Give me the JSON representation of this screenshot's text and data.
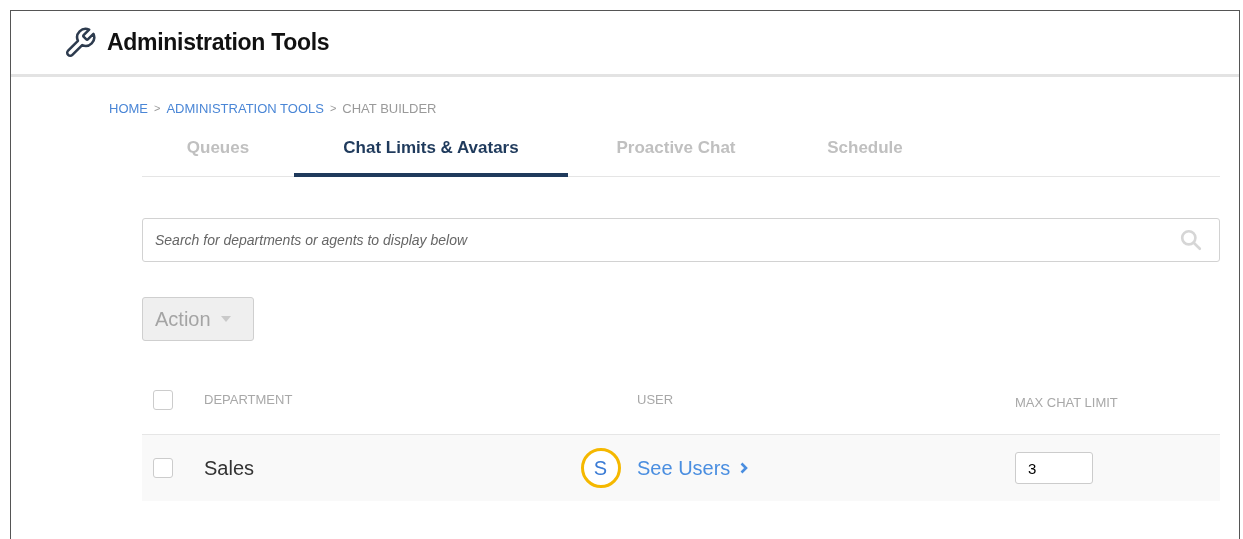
{
  "header": {
    "title": "Administration Tools"
  },
  "breadcrumb": [
    {
      "label": "HOME",
      "kind": "link"
    },
    {
      "label": "ADMINISTRATION TOOLS",
      "kind": "link"
    },
    {
      "label": "CHAT BUILDER",
      "kind": "current"
    }
  ],
  "breadcrumb_separator": ">",
  "tabs": [
    {
      "label": "Queues",
      "selected": false
    },
    {
      "label": "Chat Limits & Avatars",
      "selected": true
    },
    {
      "label": "Proactive Chat",
      "selected": false
    },
    {
      "label": "Schedule",
      "selected": false
    }
  ],
  "search": {
    "placeholder": "Search for departments or agents to display below"
  },
  "action_button": {
    "label": "Action",
    "disabled": true
  },
  "table": {
    "select_all_checked": false,
    "columns": [
      "DEPARTMENT",
      "USER",
      "MAX CHAT LIMIT"
    ],
    "rows": [
      {
        "checked": false,
        "department": "Sales",
        "avatar": "S",
        "users_link": "See Users",
        "max_chat_limit": "3"
      }
    ]
  }
}
